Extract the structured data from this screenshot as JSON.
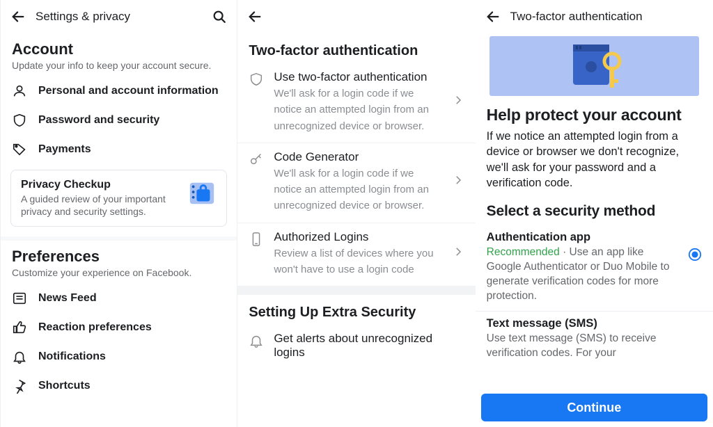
{
  "panel1": {
    "header_title": "Settings & privacy",
    "account": {
      "heading": "Account",
      "sub": "Update your info to keep your account secure.",
      "rows": [
        {
          "label": "Personal and account information"
        },
        {
          "label": "Password and security"
        },
        {
          "label": "Payments"
        }
      ],
      "card": {
        "title": "Privacy Checkup",
        "sub": "A guided review of your important privacy and security settings."
      }
    },
    "preferences": {
      "heading": "Preferences",
      "sub": "Customize your experience on Facebook.",
      "rows": [
        {
          "label": "News Feed"
        },
        {
          "label": "Reaction preferences"
        },
        {
          "label": "Notifications"
        },
        {
          "label": "Shortcuts"
        }
      ]
    }
  },
  "panel2": {
    "section1_title": "Two-factor authentication",
    "items": [
      {
        "title": "Use two-factor authentication",
        "sub": "We'll ask for a login code if we notice an attempted login from an unrecognized device or browser."
      },
      {
        "title": "Code Generator",
        "sub": "We'll ask for a login code if we notice an attempted login from an unrecognized device or browser."
      },
      {
        "title": "Authorized Logins",
        "sub": "Review a list of devices where you won't have to use a login code"
      }
    ],
    "section2_title": "Setting Up Extra Security",
    "extra_item_title": "Get alerts about unrecognized logins"
  },
  "panel3": {
    "header_title": "Two-factor authentication",
    "h1": "Help protect your account",
    "p": "If we notice an attempted login from a device or browser we don't recognize, we'll ask for your password and a verification code.",
    "h2": "Select a security method",
    "methods": [
      {
        "title": "Authentication app",
        "recommended": "Recommended",
        "sep": " · ",
        "sub": "Use an app like Google Authenticator or Duo Mobile to generate verification codes for more protection.",
        "selected": true
      },
      {
        "title": "Text message (SMS)",
        "sub": "Use text message (SMS) to receive verification codes. For your",
        "selected": false
      }
    ],
    "cta": "Continue"
  }
}
